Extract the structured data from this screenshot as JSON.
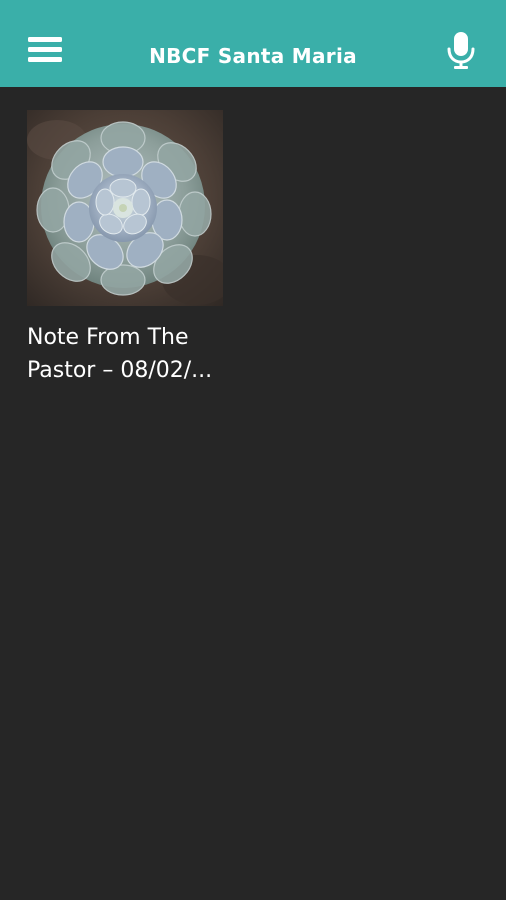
{
  "header": {
    "title": "NBCF Santa Maria",
    "menu_icon": "hamburger-menu-icon",
    "mic_icon": "microphone-icon",
    "background_color": "#3aafa9"
  },
  "content": {
    "background_color": "#262626",
    "items": [
      {
        "title_line1": "Note From The",
        "title_line2": "Pastor – 08/02/...",
        "thumbnail": "succulent-photo"
      }
    ]
  }
}
